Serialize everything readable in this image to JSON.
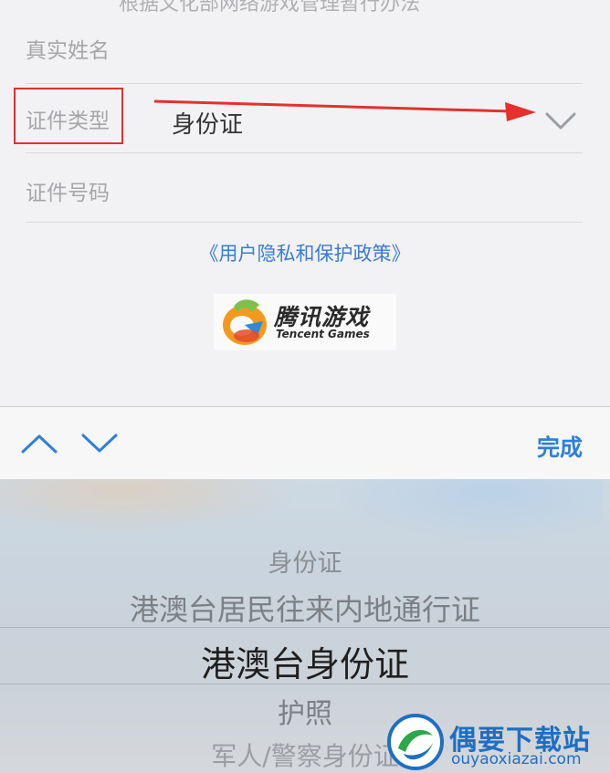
{
  "form": {
    "top_partial_text": "根据文化部网络游戏管理暂行办法",
    "real_name_label": "真实姓名",
    "id_type_label": "证件类型",
    "id_type_value": "身份证",
    "id_number_label": "证件号码",
    "privacy_link": "《用户隐私和保护政策》"
  },
  "logo": {
    "cn": "腾讯游戏",
    "en": "Tencent Games"
  },
  "toolbar": {
    "done_label": "完成"
  },
  "picker": {
    "options": [
      "身份证",
      "港澳台居民往来内地通行证",
      "港澳台身份证",
      "护照",
      "军人/警察身份证"
    ],
    "selected_index": 2
  },
  "watermark": {
    "cn": "偶要下载站",
    "en": "ouyaoxiazai.com"
  },
  "colors": {
    "accent": "#2f7fdb",
    "annotation": "#e5302c",
    "link": "#3a7bd5"
  }
}
